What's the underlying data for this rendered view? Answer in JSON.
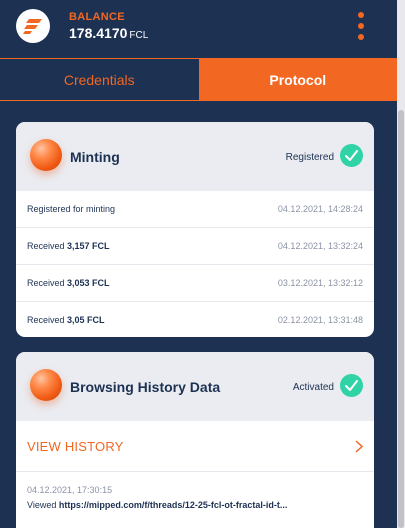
{
  "colors": {
    "accent": "#f26722",
    "navy": "#1d3152",
    "success": "#2fd3a6"
  },
  "header": {
    "balance_label": "BALANCE",
    "balance_value": "178.4170",
    "balance_unit": "FCL",
    "logo_icon": "fractal-logo-icon",
    "menu_icon": "kebab-menu-icon"
  },
  "tabs": [
    {
      "label": "Credentials",
      "active": false
    },
    {
      "label": "Protocol",
      "active": true
    }
  ],
  "minting": {
    "title": "Minting",
    "status": "Registered",
    "status_icon": "check-circle-icon",
    "rows": [
      {
        "prefix": "Registered for minting",
        "amount": "",
        "date": "04.12.2021, 14:28:24"
      },
      {
        "prefix": "Received ",
        "amount": "3,157 FCL",
        "date": "04.12.2021, 13:32:24"
      },
      {
        "prefix": "Received ",
        "amount": "3,053 FCL",
        "date": "03.12.2021, 13:32:12"
      },
      {
        "prefix": "Received ",
        "amount": "3,05 FCL",
        "date": "02.12.2021, 13:31:48"
      }
    ]
  },
  "browsing": {
    "title": "Browsing History Data",
    "status": "Activated",
    "status_icon": "check-circle-icon",
    "view_history_label": "VIEW HISTORY",
    "entry": {
      "date": "04.12.2021, 17:30:15",
      "prefix": "Viewed ",
      "url": "https://mipped.com/f/threads/12-25-fcl-ot-fractal-id-t..."
    }
  }
}
